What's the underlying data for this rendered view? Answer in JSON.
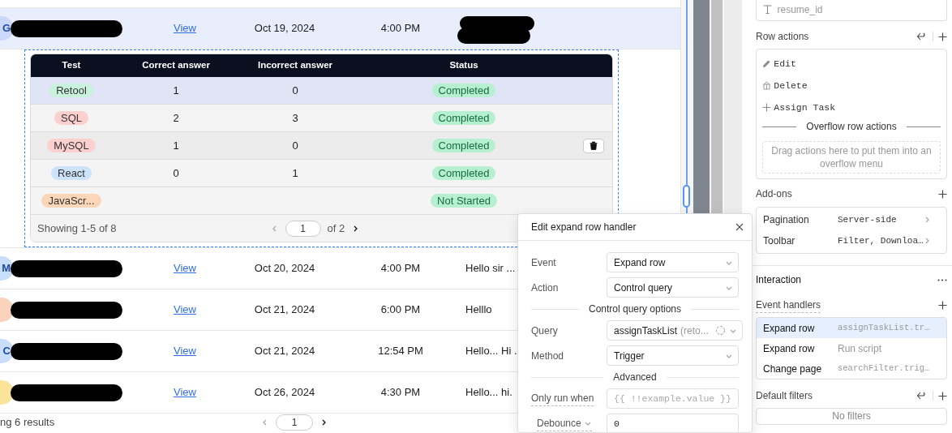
{
  "main_table": {
    "rows": [
      {
        "avatar": {
          "initials": "G",
          "color": "#cad8fb"
        },
        "name_redacted": true,
        "link": "View",
        "date": "Oct 19, 2024",
        "time": "4:00 PM",
        "message_redacted": true,
        "selected": true,
        "expanded": true
      },
      {
        "avatar": {
          "initials": "M",
          "color": "#c9defa"
        },
        "name_redacted": true,
        "link": "View",
        "date": "Oct 20, 2024",
        "time": "4:00 PM",
        "message": "Hello sir ...",
        "selected": false,
        "expanded": false
      },
      {
        "avatar": {
          "color": "#fbd3bd"
        },
        "name_redacted": true,
        "link": "View",
        "date": "Oct 21, 2024",
        "time": "6:00 PM",
        "message": "Helllo",
        "selected": false,
        "expanded": false
      },
      {
        "avatar": {
          "initials": "C",
          "color": "#c9defa"
        },
        "name_redacted": true,
        "link": "View",
        "date": "Oct 21, 2024",
        "time": "12:54 PM",
        "message": "Hello... Hi .",
        "selected": false,
        "expanded": false
      },
      {
        "avatar": {
          "color": "#fbe49a"
        },
        "name_redacted": true,
        "link": "View",
        "date": "Oct 26, 2024",
        "time": "4:30 PM",
        "message": "Hello... hi.",
        "selected": false,
        "expanded": false
      }
    ],
    "detail": {
      "columns": [
        "Test",
        "Correct answer",
        "Incorrect answer",
        "Status"
      ],
      "rows": [
        {
          "test": {
            "label": "Retool",
            "color": "#c9f2dc"
          },
          "correct": "1",
          "incorrect": "0",
          "status": {
            "label": "Completed",
            "color": "#b7f0d0"
          },
          "selected": true,
          "hovered": false
        },
        {
          "test": {
            "label": "SQL",
            "color": "#fdd0d0"
          },
          "correct": "2",
          "incorrect": "3",
          "status": {
            "label": "Completed",
            "color": "#b7f0d0"
          },
          "selected": false,
          "hovered": false
        },
        {
          "test": {
            "label": "MySQL",
            "color": "#fdd0d0"
          },
          "correct": "1",
          "incorrect": "0",
          "status": {
            "label": "Completed",
            "color": "#b7f0d0"
          },
          "selected": false,
          "hovered": true
        },
        {
          "test": {
            "label": "React",
            "color": "#cde3fb"
          },
          "correct": "0",
          "incorrect": "1",
          "status": {
            "label": "Completed",
            "color": "#b7f0d0"
          },
          "selected": false,
          "hovered": false
        },
        {
          "test": {
            "label": "JavaScr...",
            "color": "#fbd6b8"
          },
          "status": {
            "label": "Not Started",
            "color": "#b7f0d0"
          },
          "selected": false,
          "hovered": false
        }
      ],
      "footer": {
        "summary": "Showing 1-5 of 8",
        "page": "1",
        "page_count": "of 2"
      }
    },
    "footer": {
      "summary": "ng 6 results",
      "page": "1"
    }
  },
  "handler_editor": {
    "title": "Edit expand row handler",
    "fields": [
      {
        "kind": "select",
        "label": "Event",
        "value": "Expand row"
      },
      {
        "kind": "select",
        "label": "Action",
        "value": "Control query"
      },
      {
        "kind": "divider",
        "label": "Control query options"
      },
      {
        "kind": "query",
        "label": "Query",
        "value": "assignTaskList",
        "hint": "(reto..."
      },
      {
        "kind": "select",
        "label": "Method",
        "value": "Trigger"
      },
      {
        "kind": "divider",
        "label": "Advanced"
      },
      {
        "kind": "code",
        "label": "Only run when",
        "placeholder": "{{ !!example.value }}"
      },
      {
        "kind": "code-menu",
        "label": "Debounce",
        "value": "0"
      }
    ]
  },
  "inspector": {
    "top_field": {
      "value": "resume_id"
    },
    "row_actions": {
      "title": "Row actions",
      "items": [
        {
          "kind": "edit",
          "label": "Edit"
        },
        {
          "kind": "delete",
          "label": "Delete"
        },
        {
          "kind": "add",
          "label": "Assign Task"
        }
      ],
      "overflow_title": "Overflow row actions",
      "overflow_hint": "Drag actions here to put them into an overflow menu"
    },
    "addons": {
      "title": "Add-ons",
      "items": [
        {
          "label": "Pagination",
          "value": "Server-side"
        },
        {
          "label": "Toolbar",
          "value": "Filter, Downloa…"
        }
      ]
    },
    "interaction": {
      "title": "Interaction",
      "handlers_title": "Event handlers",
      "handlers": [
        {
          "event": "Expand row",
          "action": "assignTaskList.tr…",
          "code": true,
          "selected": true
        },
        {
          "event": "Expand row",
          "action": "Run script",
          "code": false,
          "selected": false
        },
        {
          "event": "Change page",
          "action": "searchFilter.trig…",
          "code": true,
          "selected": false
        }
      ]
    },
    "default_filters": {
      "title": "Default filters",
      "empty": "No filters"
    }
  }
}
